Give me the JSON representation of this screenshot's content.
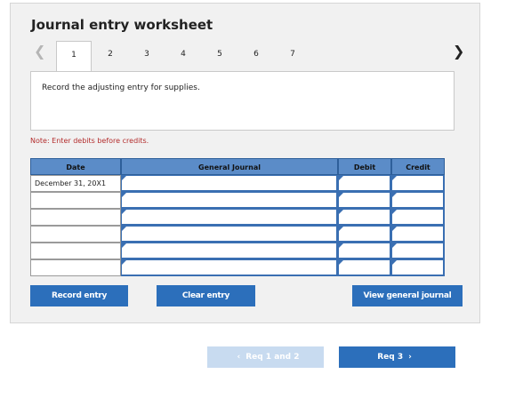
{
  "worksheet": {
    "title": "Journal entry worksheet",
    "tabs": [
      "1",
      "2",
      "3",
      "4",
      "5",
      "6",
      "7"
    ],
    "active_tab": "1",
    "instruction": "Record the adjusting entry for supplies.",
    "note": "Note: Enter debits before credits."
  },
  "icons": {
    "prev": "chevron-left-icon",
    "next": "chevron-right-icon"
  },
  "table": {
    "headers": {
      "date": "Date",
      "general_journal": "General Journal",
      "debit": "Debit",
      "credit": "Credit"
    },
    "rows": [
      {
        "date": "December 31, 20X1",
        "general_journal": "",
        "debit": "",
        "credit": ""
      },
      {
        "date": "",
        "general_journal": "",
        "debit": "",
        "credit": ""
      },
      {
        "date": "",
        "general_journal": "",
        "debit": "",
        "credit": ""
      },
      {
        "date": "",
        "general_journal": "",
        "debit": "",
        "credit": ""
      },
      {
        "date": "",
        "general_journal": "",
        "debit": "",
        "credit": ""
      },
      {
        "date": "",
        "general_journal": "",
        "debit": "",
        "credit": ""
      }
    ]
  },
  "buttons": {
    "record_entry": "Record entry",
    "clear_entry": "Clear entry",
    "view_general_journal": "View general journal"
  },
  "navigation": {
    "prev_label": "Req 1 and 2",
    "next_label": "Req 3"
  },
  "colors": {
    "accent": "#2c6fbb",
    "header_bg": "#5b8cc8",
    "disabled_button": "#c8dbf0",
    "note_text": "#b32d2d"
  }
}
